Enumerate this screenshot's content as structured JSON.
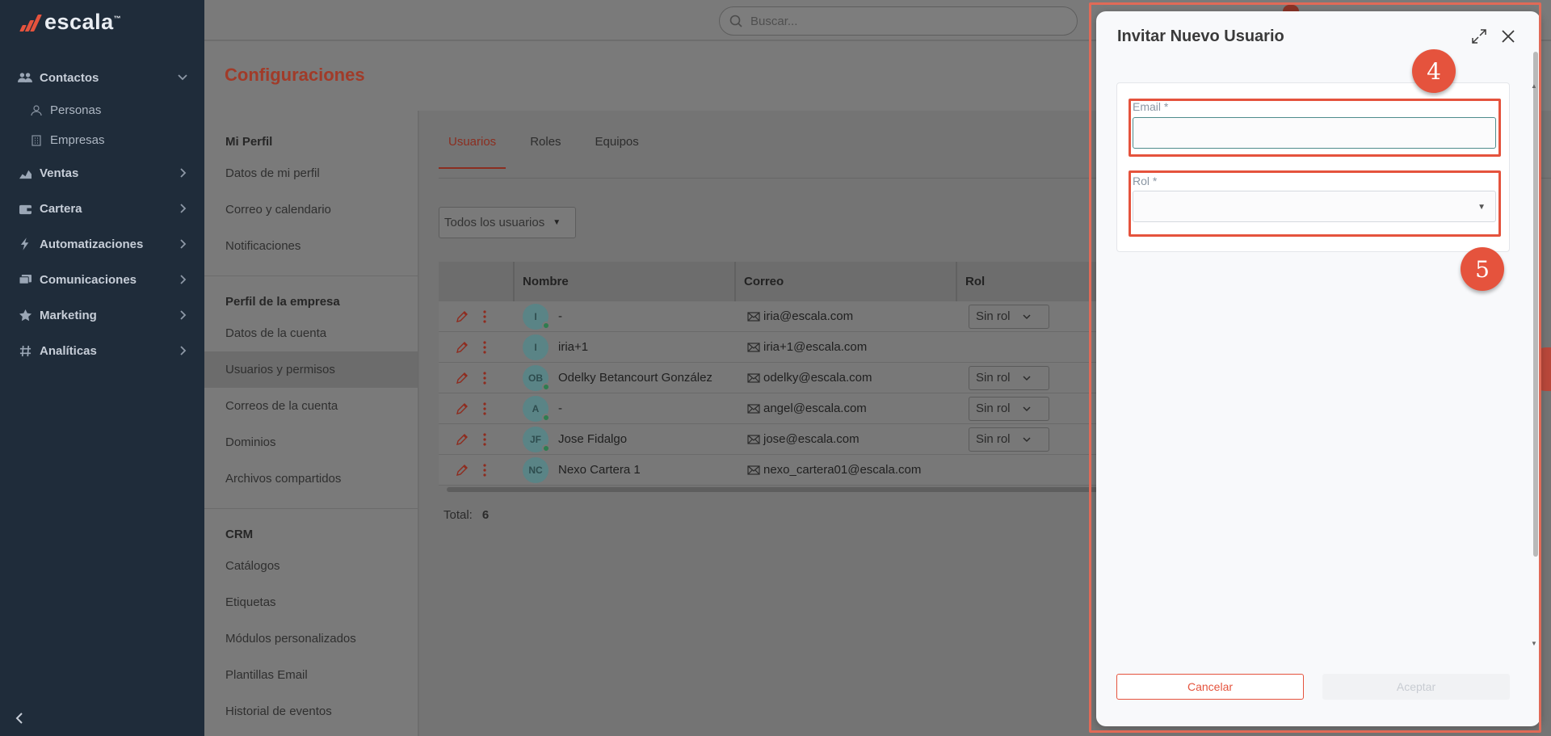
{
  "app": {
    "logo_text": "escala"
  },
  "search": {
    "placeholder": "Buscar..."
  },
  "sidebar": {
    "items": [
      {
        "label": "Contactos",
        "icon": "users-icon",
        "expanded": true,
        "children": [
          {
            "label": "Personas",
            "icon": "person-icon"
          },
          {
            "label": "Empresas",
            "icon": "building-icon"
          }
        ]
      },
      {
        "label": "Ventas",
        "icon": "chart-icon"
      },
      {
        "label": "Cartera",
        "icon": "wallet-icon"
      },
      {
        "label": "Automatizaciones",
        "icon": "bolt-icon"
      },
      {
        "label": "Comunicaciones",
        "icon": "chat-icon"
      },
      {
        "label": "Marketing",
        "icon": "star-icon"
      },
      {
        "label": "Analíticas",
        "icon": "hash-icon"
      }
    ]
  },
  "page": {
    "title": "Configuraciones"
  },
  "settings_nav": {
    "mi_perfil": {
      "title": "Mi Perfil",
      "items": [
        "Datos de mi perfil",
        "Correo y calendario",
        "Notificaciones"
      ]
    },
    "empresa": {
      "title": "Perfil de la empresa",
      "items": [
        "Datos de la cuenta",
        "Usuarios y permisos",
        "Correos de la cuenta",
        "Dominios",
        "Archivos compartidos"
      ]
    },
    "crm": {
      "title": "CRM",
      "items": [
        "Catálogos",
        "Etiquetas",
        "Módulos personalizados",
        "Plantillas Email",
        "Historial de eventos"
      ]
    }
  },
  "tabs": [
    "Usuarios",
    "Roles",
    "Equipos"
  ],
  "filter": {
    "label": "Todos los usuarios"
  },
  "table": {
    "columns": [
      "Nombre",
      "Correo",
      "Rol"
    ],
    "rows": [
      {
        "initials": "I",
        "name": "-",
        "email": "iria@escala.com",
        "rol": "Sin rol",
        "online": true
      },
      {
        "initials": "I",
        "name": "iria+1",
        "email": "iria+1@escala.com",
        "rol": "",
        "online": false
      },
      {
        "initials": "OB",
        "name": "Odelky Betancourt González",
        "email": "odelky@escala.com",
        "rol": "Sin rol",
        "online": true
      },
      {
        "initials": "A",
        "name": "-",
        "email": "angel@escala.com",
        "rol": "Sin rol",
        "online": true
      },
      {
        "initials": "JF",
        "name": "Jose Fidalgo",
        "email": "jose@escala.com",
        "rol": "Sin rol",
        "online": true
      },
      {
        "initials": "NC",
        "name": "Nexo Cartera 1",
        "email": "nexo_cartera01@escala.com",
        "rol": "",
        "online": false
      }
    ],
    "total_label": "Total:",
    "total_value": "6"
  },
  "modal": {
    "title": "Invitar Nuevo Usuario",
    "email_label": "Email *",
    "email_value": "",
    "rol_label": "Rol *",
    "rol_value": "",
    "cancel_label": "Cancelar",
    "accept_label": "Aceptar"
  },
  "annotations": {
    "badge_email": "4",
    "badge_rol": "5"
  },
  "colors": {
    "accent": "#e5533d",
    "sidebar_bg": "#1f2c3a",
    "modal_bg": "#f8f9fb"
  }
}
